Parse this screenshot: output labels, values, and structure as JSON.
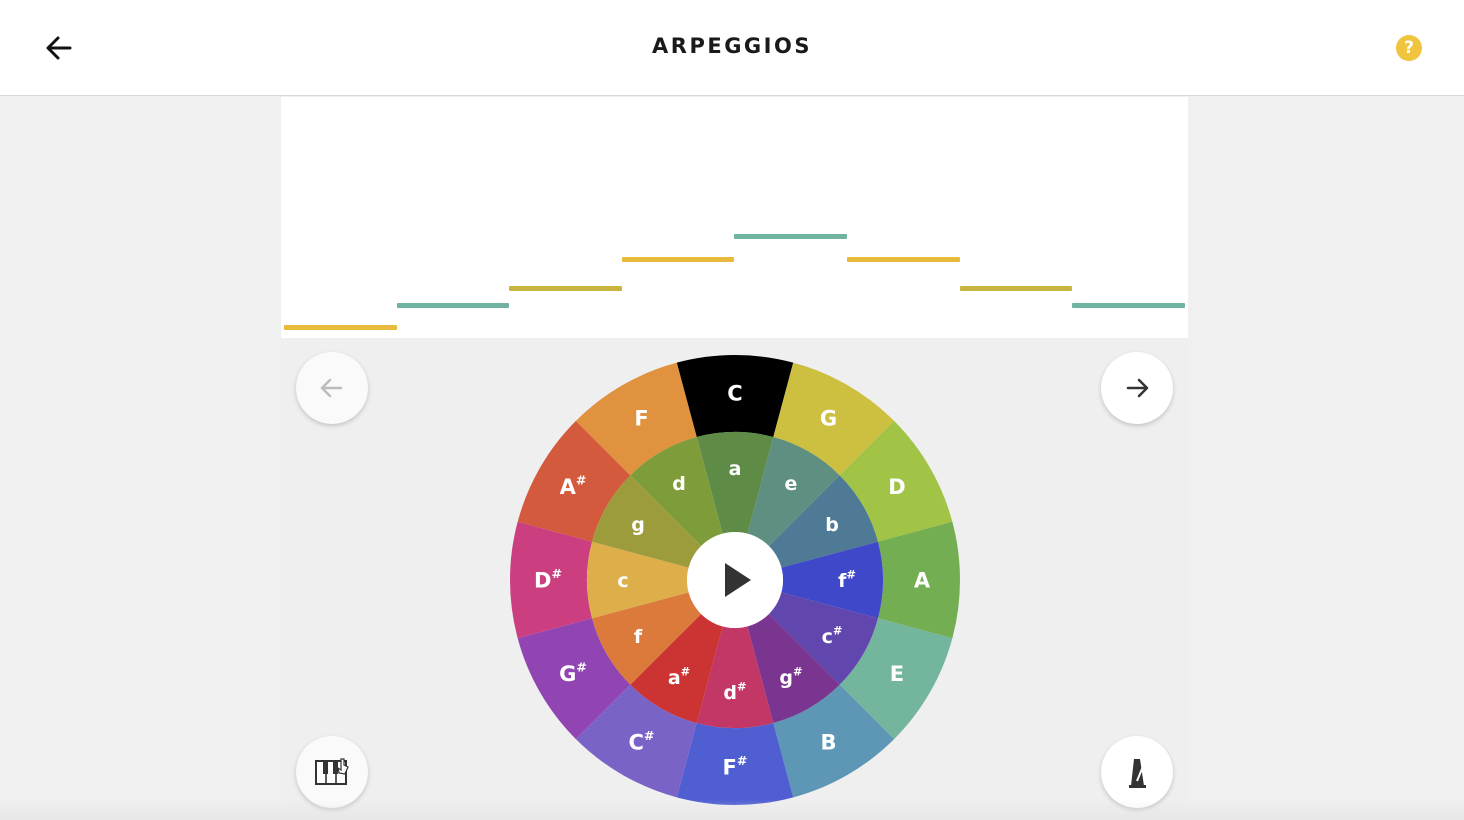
{
  "header": {
    "title": "ARPEGGIOS",
    "back_icon": "arrow-left-icon",
    "help_label": "?",
    "help_color": "#f0c43e"
  },
  "note_roll": {
    "notes": [
      {
        "step": 0,
        "level": 0,
        "color": "#e8b93c"
      },
      {
        "step": 1,
        "level": 1,
        "color": "#6fb3a0"
      },
      {
        "step": 2,
        "level": 2,
        "color": "#c7b540"
      },
      {
        "step": 3,
        "level": 3,
        "color": "#e8b93c"
      },
      {
        "step": 4,
        "level": 4,
        "color": "#6fb3a0"
      },
      {
        "step": 5,
        "level": 3,
        "color": "#e8b93c"
      },
      {
        "step": 6,
        "level": 2,
        "color": "#c7b540"
      },
      {
        "step": 7,
        "level": 1,
        "color": "#6fb3a0"
      }
    ]
  },
  "controls": {
    "prev_icon": "arrow-left-icon",
    "next_icon": "arrow-right-icon",
    "play_icon": "play-icon",
    "piano_icon": "piano-icon",
    "metronome_icon": "metronome-icon"
  },
  "wheel": {
    "selected": "C",
    "outer": [
      {
        "name": "C",
        "sup": "",
        "color": "#000000"
      },
      {
        "name": "G",
        "sup": "",
        "color": "#cdbf3f"
      },
      {
        "name": "D",
        "sup": "",
        "color": "#a2c446"
      },
      {
        "name": "A",
        "sup": "",
        "color": "#74ae52"
      },
      {
        "name": "E",
        "sup": "",
        "color": "#74b59e"
      },
      {
        "name": "B",
        "sup": "",
        "color": "#5e97b6"
      },
      {
        "name": "F",
        "sup": "#",
        "color": "#4f5fd2"
      },
      {
        "name": "C",
        "sup": "#",
        "color": "#7a63c6"
      },
      {
        "name": "G",
        "sup": "#",
        "color": "#9045b3"
      },
      {
        "name": "D",
        "sup": "#",
        "color": "#cb3f80"
      },
      {
        "name": "A",
        "sup": "#",
        "color": "#d35a3d"
      },
      {
        "name": "F",
        "sup": "",
        "color": "#e0923e"
      }
    ],
    "inner": [
      {
        "name": "a",
        "sup": "",
        "color": "#5e8c46"
      },
      {
        "name": "e",
        "sup": "",
        "color": "#5e8f80"
      },
      {
        "name": "b",
        "sup": "",
        "color": "#4f7a96"
      },
      {
        "name": "f",
        "sup": "#",
        "color": "#3f48c8"
      },
      {
        "name": "c",
        "sup": "#",
        "color": "#6046ad"
      },
      {
        "name": "g",
        "sup": "#",
        "color": "#7a3590"
      },
      {
        "name": "d",
        "sup": "#",
        "color": "#c23766"
      },
      {
        "name": "a",
        "sup": "#",
        "color": "#cc3433"
      },
      {
        "name": "f",
        "sup": "",
        "color": "#db7a3a"
      },
      {
        "name": "c",
        "sup": "",
        "color": "#ddae4a"
      },
      {
        "name": "g",
        "sup": "",
        "color": "#9c9c3c"
      },
      {
        "name": "d",
        "sup": "",
        "color": "#7f9c3a"
      }
    ]
  }
}
